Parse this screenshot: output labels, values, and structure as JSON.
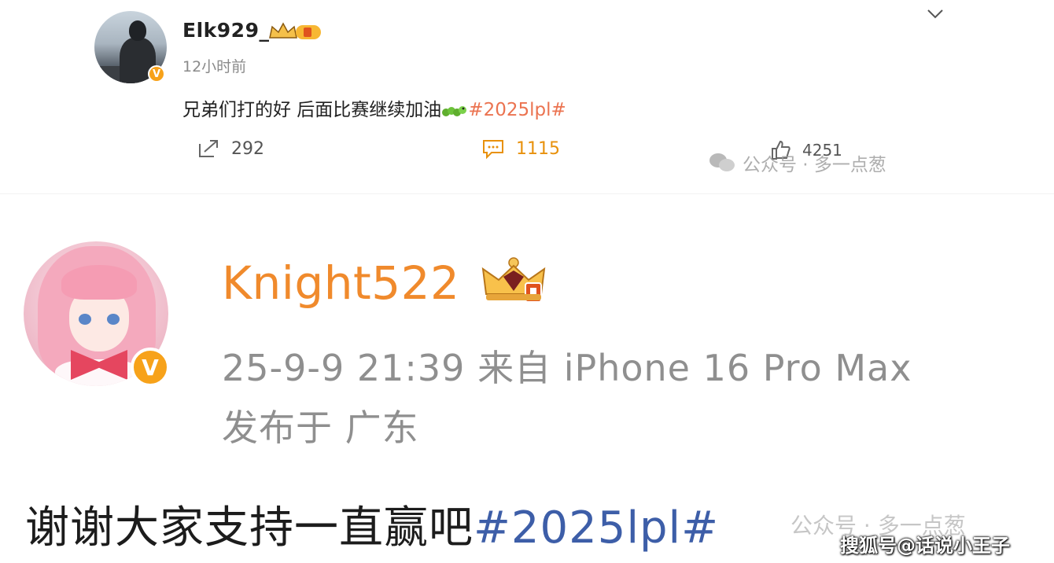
{
  "post1": {
    "username": "Elk929_",
    "time": "12小时前",
    "content_text": "兄弟们打的好 后面比赛继续加油",
    "content_tag": "#2025lpl#",
    "actions": {
      "repost_count": "292",
      "comment_count": "1115",
      "like_count": "4251"
    }
  },
  "watermark1": "公众号 · 多一点葱",
  "post2": {
    "username": "Knight522",
    "meta": "25-9-9 21:39  来自 iPhone 16 Pro Max",
    "location": "发布于 广东",
    "content_text": "谢谢大家支持一直赢吧",
    "content_tag": "#2025lpl#"
  },
  "watermark2": "公众号 · 多一点葱",
  "source_watermark": "搜狐号@话说小王子",
  "icons": {
    "verified": "V",
    "colors": {
      "accent_orange": "#eb7350",
      "vip_gold": "#f7a21a",
      "tag_blue": "#3d5ea8"
    }
  }
}
